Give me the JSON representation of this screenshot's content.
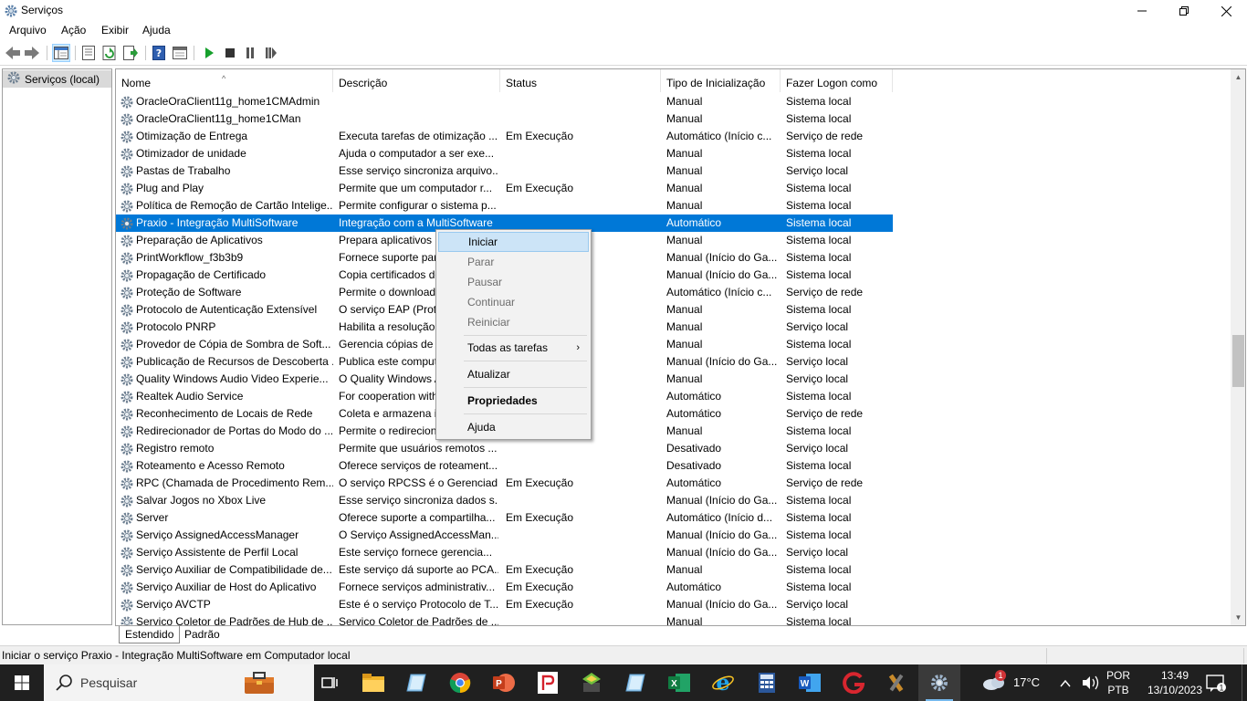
{
  "window": {
    "title": "Serviços",
    "icon": "gear-icon"
  },
  "menu": {
    "items": [
      "Arquivo",
      "Ação",
      "Exibir",
      "Ajuda"
    ]
  },
  "tree": {
    "item": "Serviços (local)"
  },
  "columns": {
    "name": "Nome",
    "desc": "Descrição",
    "status": "Status",
    "tipo": "Tipo de Inicialização",
    "logon": "Fazer Logon como"
  },
  "rows": [
    {
      "name": "OracleOraClient11g_home1CMAdmin",
      "desc": "",
      "status": "",
      "tipo": "Manual",
      "logon": "Sistema local"
    },
    {
      "name": "OracleOraClient11g_home1CMan",
      "desc": "",
      "status": "",
      "tipo": "Manual",
      "logon": "Sistema local"
    },
    {
      "name": "Otimização de Entrega",
      "desc": "Executa tarefas de otimização ...",
      "status": "Em Execução",
      "tipo": "Automático (Início c...",
      "logon": "Serviço de rede"
    },
    {
      "name": "Otimizador de unidade",
      "desc": "Ajuda o computador a ser exe...",
      "status": "",
      "tipo": "Manual",
      "logon": "Sistema local"
    },
    {
      "name": "Pastas de Trabalho",
      "desc": "Esse serviço sincroniza arquivo...",
      "status": "",
      "tipo": "Manual",
      "logon": "Serviço local"
    },
    {
      "name": "Plug and Play",
      "desc": "Permite que um computador r...",
      "status": "Em Execução",
      "tipo": "Manual",
      "logon": "Sistema local"
    },
    {
      "name": "Política de Remoção de Cartão Intelige...",
      "desc": "Permite configurar o sistema p...",
      "status": "",
      "tipo": "Manual",
      "logon": "Sistema local"
    },
    {
      "name": "Praxio - Integração MultiSoftware",
      "desc": "Integração com a MultiSoftware",
      "status": "",
      "tipo": "Automático",
      "logon": "Sistema local",
      "selected": true
    },
    {
      "name": "Preparação de Aplicativos",
      "desc": "Prepara aplicativos p",
      "status": "",
      "tipo": "Manual",
      "logon": "Sistema local"
    },
    {
      "name": "PrintWorkflow_f3b3b9",
      "desc": "Fornece suporte par",
      "status": "",
      "tipo": "Manual (Início do Ga...",
      "logon": "Sistema local"
    },
    {
      "name": "Propagação de Certificado",
      "desc": "Copia certificados do",
      "status": "",
      "tipo": "Manual (Início do Ga...",
      "logon": "Sistema local"
    },
    {
      "name": "Proteção de Software",
      "desc": "Permite o download,",
      "status": "",
      "tipo": "Automático (Início c...",
      "logon": "Serviço de rede"
    },
    {
      "name": "Protocolo de Autenticação Extensível",
      "desc": "O serviço EAP (Proto",
      "status": "",
      "tipo": "Manual",
      "logon": "Sistema local"
    },
    {
      "name": "Protocolo PNRP",
      "desc": "Habilita a resolução",
      "status": "",
      "tipo": "Manual",
      "logon": "Serviço local"
    },
    {
      "name": "Provedor de Cópia de Sombra de Soft...",
      "desc": "Gerencia cópias de s",
      "status": "",
      "tipo": "Manual",
      "logon": "Sistema local"
    },
    {
      "name": "Publicação de Recursos de Descoberta ...",
      "desc": "Publica este comput",
      "status": "",
      "tipo": "Manual (Início do Ga...",
      "logon": "Serviço local"
    },
    {
      "name": "Quality Windows Audio Video Experie...",
      "desc": "O Quality Windows A",
      "status": "",
      "tipo": "Manual",
      "logon": "Serviço local"
    },
    {
      "name": "Realtek Audio Service",
      "desc": "For cooperation with",
      "status": "",
      "tipo": "Automático",
      "logon": "Sistema local"
    },
    {
      "name": "Reconhecimento de Locais de Rede",
      "desc": "Coleta e armazena in",
      "status": "",
      "tipo": "Automático",
      "logon": "Serviço de rede"
    },
    {
      "name": "Redirecionador de Portas do Modo do ...",
      "desc": "Permite o redirecion",
      "status": "",
      "tipo": "Manual",
      "logon": "Sistema local"
    },
    {
      "name": "Registro remoto",
      "desc": "Permite que usuários remotos ...",
      "status": "",
      "tipo": "Desativado",
      "logon": "Serviço local"
    },
    {
      "name": "Roteamento e Acesso Remoto",
      "desc": "Oferece serviços de roteament...",
      "status": "",
      "tipo": "Desativado",
      "logon": "Sistema local"
    },
    {
      "name": "RPC (Chamada de Procedimento Rem...",
      "desc": "O serviço RPCSS é o Gerenciad...",
      "status": "Em Execução",
      "tipo": "Automático",
      "logon": "Serviço de rede"
    },
    {
      "name": "Salvar Jogos no Xbox Live",
      "desc": "Esse serviço sincroniza dados s...",
      "status": "",
      "tipo": "Manual (Início do Ga...",
      "logon": "Sistema local"
    },
    {
      "name": "Server",
      "desc": "Oferece suporte a compartilha...",
      "status": "Em Execução",
      "tipo": "Automático (Início d...",
      "logon": "Sistema local"
    },
    {
      "name": "Serviço AssignedAccessManager",
      "desc": "O Serviço AssignedAccessMan...",
      "status": "",
      "tipo": "Manual (Início do Ga...",
      "logon": "Sistema local"
    },
    {
      "name": "Serviço Assistente de Perfil Local",
      "desc": "Este serviço fornece gerencia...",
      "status": "",
      "tipo": "Manual (Início do Ga...",
      "logon": "Serviço local"
    },
    {
      "name": "Serviço Auxiliar de Compatibilidade de...",
      "desc": "Este serviço dá suporte ao PCA...",
      "status": "Em Execução",
      "tipo": "Manual",
      "logon": "Sistema local"
    },
    {
      "name": "Serviço Auxiliar de Host do Aplicativo",
      "desc": "Fornece serviços administrativ...",
      "status": "Em Execução",
      "tipo": "Automático",
      "logon": "Sistema local"
    },
    {
      "name": "Serviço AVCTP",
      "desc": "Este é o serviço Protocolo de T...",
      "status": "Em Execução",
      "tipo": "Manual (Início do Ga...",
      "logon": "Serviço local"
    },
    {
      "name": "Serviço Coletor de Padrões de Hub de ...",
      "desc": "Serviço Coletor de Padrões de ...",
      "status": "",
      "tipo": "Manual",
      "logon": "Sistema local"
    }
  ],
  "context_menu": {
    "iniciar": "Iniciar",
    "parar": "Parar",
    "pausar": "Pausar",
    "continuar": "Continuar",
    "reiniciar": "Reiniciar",
    "todas": "Todas as tarefas",
    "atualizar": "Atualizar",
    "propriedades": "Propriedades",
    "ajuda": "Ajuda"
  },
  "tabs": {
    "estendido": "Estendido",
    "padrao": "Padrão"
  },
  "status_bar": {
    "text": "Iniciar o serviço Praxio - Integração MultiSoftware em Computador local"
  },
  "taskbar": {
    "search_placeholder": "Pesquisar",
    "weather": "17°C",
    "weather_badge": "1",
    "lang1": "POR",
    "lang2": "PTB",
    "time": "13:49",
    "date": "13/10/2023"
  },
  "colors": {
    "selection": "#0078d7",
    "menu_hover": "#cce4f7",
    "taskbar": "#202020"
  }
}
